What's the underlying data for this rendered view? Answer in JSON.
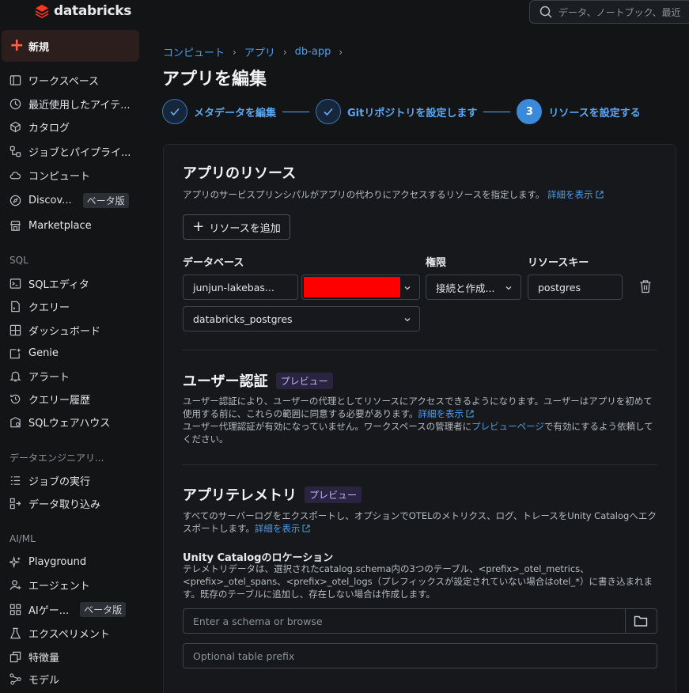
{
  "app": {
    "brand": "databricks",
    "brand_color": "#ff3621",
    "accent": "#4a9ff2"
  },
  "search": {
    "placeholder": "データ、ノートブック、最近"
  },
  "sidebar": {
    "new_label": "新規",
    "items": [
      {
        "label": "ワークスペース",
        "icon": "workspace-icon"
      },
      {
        "label": "最近使用したアイテ...",
        "icon": "clock-icon"
      },
      {
        "label": "カタログ",
        "icon": "catalog-icon"
      },
      {
        "label": "ジョブとパイプライ...",
        "icon": "workflow-icon"
      },
      {
        "label": "コンピュート",
        "icon": "cloud-icon"
      },
      {
        "label": "Discov...",
        "icon": "compass-icon",
        "badge": "ベータ版"
      },
      {
        "label": "Marketplace",
        "icon": "store-icon"
      }
    ],
    "sql_section": "SQL",
    "sql_items": [
      {
        "label": "SQLエディタ",
        "icon": "sql-editor-icon"
      },
      {
        "label": "クエリー",
        "icon": "query-icon"
      },
      {
        "label": "ダッシュボード",
        "icon": "dashboard-icon"
      },
      {
        "label": "Genie",
        "icon": "genie-icon"
      },
      {
        "label": "アラート",
        "icon": "bell-icon"
      },
      {
        "label": "クエリー履歴",
        "icon": "history-icon"
      },
      {
        "label": "SQLウェアハウス",
        "icon": "warehouse-icon"
      }
    ],
    "de_section": "データエンジニアリ...",
    "de_items": [
      {
        "label": "ジョブの実行",
        "icon": "job-runs-icon"
      },
      {
        "label": "データ取り込み",
        "icon": "ingestion-icon"
      }
    ],
    "ai_section": "AI/ML",
    "ai_items": [
      {
        "label": "Playground",
        "icon": "sparkle-icon"
      },
      {
        "label": "エージェント",
        "icon": "agent-icon"
      },
      {
        "label": "AIゲー...",
        "icon": "gateway-icon",
        "badge": "ベータ版"
      },
      {
        "label": "エクスペリメント",
        "icon": "flask-icon"
      },
      {
        "label": "特徴量",
        "icon": "features-icon"
      },
      {
        "label": "モデル",
        "icon": "model-icon"
      }
    ]
  },
  "main": {
    "breadcrumb": [
      "コンピュート",
      "アプリ",
      "db-app"
    ],
    "title": "アプリを編集",
    "steps": [
      {
        "label": "メタデータを編集",
        "state": "done"
      },
      {
        "label": "Gitリポジトリを設定します",
        "state": "done"
      },
      {
        "label": "リソースを設定する",
        "state": "active",
        "number": "3"
      }
    ],
    "resources": {
      "title": "アプリのリソース",
      "desc": "アプリのサービスプリンシパルがアプリの代わりにアクセスするリソースを指定します。",
      "link": "詳細を表示",
      "add_button": "リソースを追加",
      "col_database": "データベース",
      "col_permission": "権限",
      "col_key": "リソースキー",
      "instance_value": "junjun-lakebas...",
      "permission_value": "接続と作成...",
      "key_value": "postgres",
      "database_value": "databricks_postgres"
    },
    "auth": {
      "title": "ユーザー認証",
      "badge": "プレビュー",
      "desc1": "ユーザー認証により、ユーザーの代理としてリソースにアクセスできるようになります。ユーザーはアプリを初めて使用する前に、これらの範囲に同意する必要があります。",
      "link1": "詳細を表示",
      "desc2a": "ユーザー代理認証が有効になっていません。ワークスペースの管理者に",
      "link2": "プレビューページ",
      "desc2b": "で有効にするよう依頼してください。"
    },
    "telemetry": {
      "title": "アプリテレメトリ",
      "badge": "プレビュー",
      "desc": "すべてのサーバーログをエクスポートし、オプションでOTELのメトリクス、ログ、トレースをUnity Catalogへエクスポートします。",
      "link": "詳細を表示",
      "uc_title": "Unity Catalogのロケーション",
      "uc_desc": "テレメトリデータは、選択されたcatalog.schema内の3つのテーブル、<prefix>_otel_metrics、<prefix>_otel_spans、<prefix>_otel_logs（プレフィックスが設定されていない場合はotel_*）に書き込まれます。既存のテーブルに追加し、存在しない場合は作成します。",
      "schema_placeholder": "Enter a schema or browse",
      "prefix_placeholder": "Optional table prefix"
    }
  }
}
